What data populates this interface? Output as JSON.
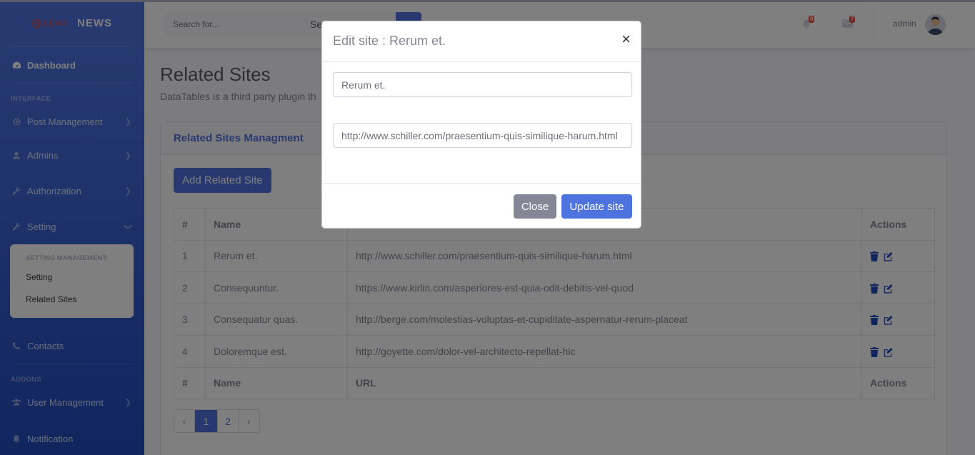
{
  "brand": {
    "logo_text": "NEWS",
    "title": "NEWS"
  },
  "sidebar": {
    "dashboard": "Dashboard",
    "heading_interface": "INTERFACE",
    "post_management": "Post Management",
    "admins": "Admins",
    "authorization": "Authorization",
    "setting": "Setting",
    "setting_menu": {
      "header": "SETTING MANAGEMENT:",
      "items": [
        "Setting",
        "Related Sites"
      ]
    },
    "contacts": "Contacts",
    "heading_addons": "ADDONS",
    "user_management": "User Management",
    "notification": "Notification"
  },
  "topbar": {
    "search_placeholder": "Search for...",
    "search_label": "Search",
    "alerts_count": "0",
    "messages_count": "7",
    "user_name": "admin"
  },
  "page": {
    "title": "Related Sites",
    "description": "DataTables is a third party plugin th"
  },
  "card": {
    "header": "Related Sites Managment",
    "add_button": "Add Related Site"
  },
  "table": {
    "columns": [
      "#",
      "Name",
      "URL",
      "Actions"
    ],
    "rows": [
      {
        "num": "1",
        "name": "Rerum et.",
        "url": "http://www.schiller.com/praesentium-quis-similique-harum.html"
      },
      {
        "num": "2",
        "name": "Consequuntur.",
        "url": "https://www.kirlin.com/asperiores-est-quia-odit-debitis-vel-quod"
      },
      {
        "num": "3",
        "name": "Consequatur quas.",
        "url": "http://berge.com/molestias-voluptas-et-cupiditate-aspernatur-rerum-placeat"
      },
      {
        "num": "4",
        "name": "Doloremque est.",
        "url": "http://goyette.com/dolor-vel-architecto-repellat-hic"
      }
    ]
  },
  "pagination": {
    "prev": "‹",
    "pages": [
      "1",
      "2"
    ],
    "next": "›",
    "current": "1"
  },
  "modal": {
    "title": "Edit site : Rerum et.",
    "close_symbol": "×",
    "name_value": "Rerum et.",
    "url_value": "http://www.schiller.com/praesentium-quis-similique-harum.html",
    "close_button": "Close",
    "update_button": "Update site"
  },
  "colors": {
    "primary": "#4e73df",
    "secondary": "#858796",
    "danger": "#e74a3b"
  }
}
